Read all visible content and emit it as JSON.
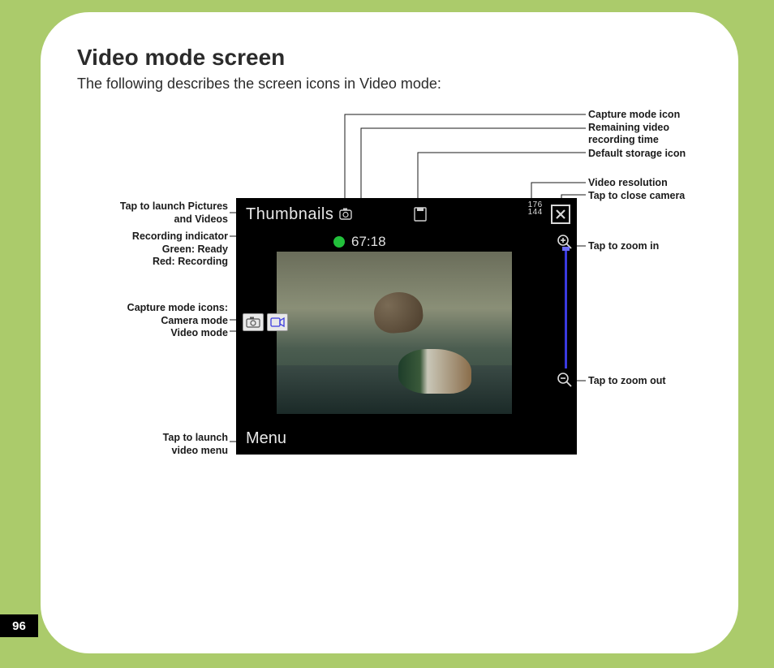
{
  "page": {
    "title": "Video mode screen",
    "subtitle": "The following describes the screen icons in Video mode:",
    "number": "96"
  },
  "screen": {
    "thumbnails_label": "Thumbnails",
    "remaining_time": "67:18",
    "resolution_top": "176",
    "resolution_bottom": "144",
    "menu_label": "Menu"
  },
  "callouts": {
    "capture_mode_icon": "Capture mode icon",
    "remaining_time_l1": "Remaining video",
    "remaining_time_l2": "recording time",
    "default_storage": "Default storage icon",
    "video_resolution": "Video resolution",
    "tap_close": "Tap to close camera",
    "tap_zoom_in": "Tap to zoom in",
    "tap_zoom_out": "Tap to zoom out",
    "thumbnails_l1": "Tap to launch Pictures",
    "thumbnails_l2": "and Videos",
    "rec_l1": "Recording indicator",
    "rec_l2": "Green: Ready",
    "rec_l3": "Red: Recording",
    "mode_header": "Capture mode icons:",
    "mode_cam": "Camera mode",
    "mode_vid": "Video mode",
    "menu_l1": "Tap to launch",
    "menu_l2": "video menu"
  }
}
